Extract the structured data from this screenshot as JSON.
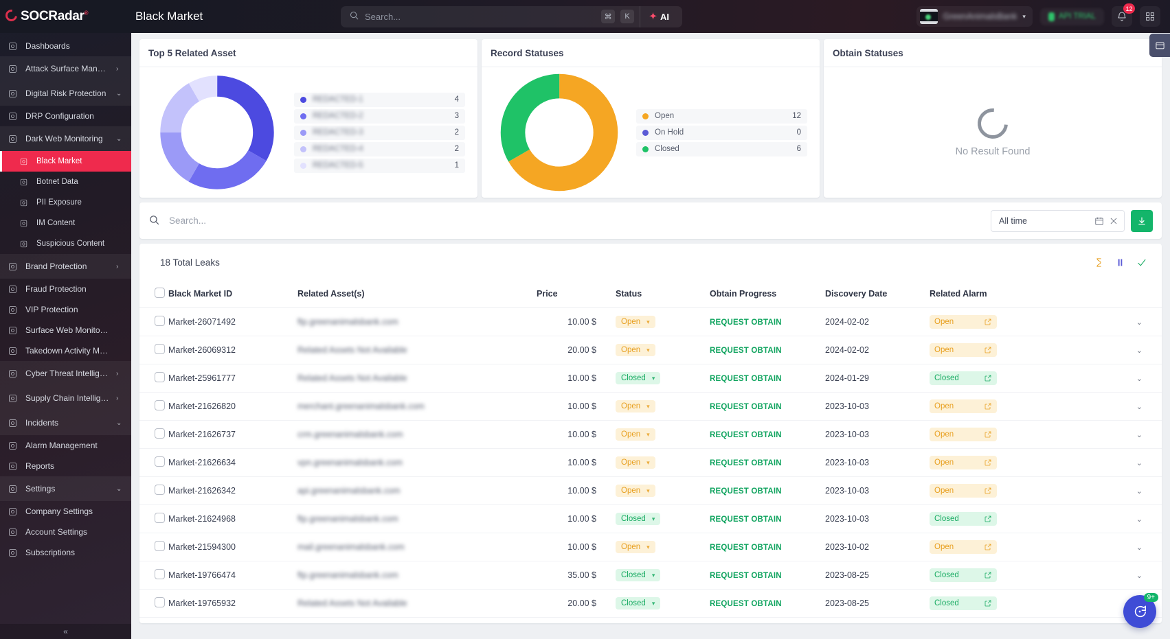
{
  "brand": {
    "name": "SOCRadar",
    "registered": "®"
  },
  "header": {
    "page_title": "Black Market",
    "search_placeholder": "Search...",
    "kbd_cmd": "⌘",
    "kbd_key": "K",
    "ai_label": "AI",
    "account_name": "GreenAnimalsBank",
    "account_caret": "▾",
    "plan_pill": "API TRIAL",
    "notifications_badge": "12",
    "icons": {
      "search": "search-icon",
      "bell": "bell-icon",
      "grid": "grid-icon"
    }
  },
  "sidebar": {
    "collapse_label": "«",
    "items": [
      {
        "label": "Dashboards",
        "icon": "dashboard-icon",
        "type": "item",
        "arrow": ""
      },
      {
        "label": "Attack Surface Management",
        "icon": "shield-scan-icon",
        "type": "group",
        "arrow": "›"
      },
      {
        "label": "Digital Risk Protection",
        "icon": "hand-shield-icon",
        "type": "group",
        "arrow": "⌄"
      },
      {
        "label": "DRP Configuration",
        "icon": "monitor-icon",
        "type": "item",
        "arrow": ""
      },
      {
        "label": "Dark Web Monitoring",
        "icon": "building-icon",
        "type": "group",
        "arrow": "⌄"
      },
      {
        "label": "Black Market",
        "icon": "market-icon",
        "type": "sub",
        "arrow": "",
        "active": true
      },
      {
        "label": "Botnet Data",
        "icon": "bug-icon",
        "type": "sub",
        "arrow": ""
      },
      {
        "label": "PII Exposure",
        "icon": "id-card-icon",
        "type": "sub",
        "arrow": ""
      },
      {
        "label": "IM Content",
        "icon": "chat-icon",
        "type": "sub",
        "arrow": ""
      },
      {
        "label": "Suspicious Content",
        "icon": "document-icon",
        "type": "sub",
        "arrow": ""
      },
      {
        "label": "Brand Protection",
        "icon": "brand-icon",
        "type": "group",
        "arrow": "›"
      },
      {
        "label": "Fraud Protection",
        "icon": "fraud-icon",
        "type": "item",
        "arrow": ""
      },
      {
        "label": "VIP Protection",
        "icon": "vip-shield-icon",
        "type": "item",
        "arrow": ""
      },
      {
        "label": "Surface Web Monitoring",
        "icon": "web-icon",
        "type": "item",
        "arrow": ""
      },
      {
        "label": "Takedown Activity Management",
        "icon": "takedown-icon",
        "type": "item",
        "arrow": ""
      },
      {
        "label": "Cyber Threat Intelligence",
        "icon": "eye-shield-icon",
        "type": "group",
        "arrow": "›"
      },
      {
        "label": "Supply Chain Intelligence",
        "icon": "factory-icon",
        "type": "group",
        "arrow": "›"
      },
      {
        "label": "Incidents",
        "icon": "incident-icon",
        "type": "group",
        "arrow": "⌄"
      },
      {
        "label": "Alarm Management",
        "icon": "alarm-icon",
        "type": "item",
        "arrow": ""
      },
      {
        "label": "Reports",
        "icon": "report-icon",
        "type": "item",
        "arrow": ""
      },
      {
        "label": "Settings",
        "icon": "gear-icon",
        "type": "group",
        "arrow": "⌄"
      },
      {
        "label": "Company Settings",
        "icon": "company-icon",
        "type": "item",
        "arrow": ""
      },
      {
        "label": "Account Settings",
        "icon": "user-icon",
        "type": "item",
        "arrow": ""
      },
      {
        "label": "Subscriptions",
        "icon": "subscription-icon",
        "type": "item",
        "arrow": ""
      }
    ]
  },
  "cards": [
    {
      "title": "Top 5 Related Asset"
    },
    {
      "title": "Record Statuses"
    },
    {
      "title": "Obtain Statuses"
    }
  ],
  "obtain_statuses": {
    "empty_text": "No Result Found"
  },
  "chart_data": [
    {
      "type": "pie",
      "title": "Top 5 Related Asset",
      "legend_position": "right",
      "categories": [
        "REDACTED-1",
        "REDACTED-2",
        "REDACTED-3",
        "REDACTED-4",
        "REDACTED-5"
      ],
      "values": [
        4,
        3,
        2,
        2,
        1
      ],
      "colors": [
        "#4c4ae0",
        "#6f6df0",
        "#9b9af7",
        "#c3c2fb",
        "#e2e1fe"
      ],
      "redacted_labels": true
    },
    {
      "type": "pie",
      "title": "Record Statuses",
      "legend_position": "right",
      "categories": [
        "Open",
        "On Hold",
        "Closed"
      ],
      "values": [
        12,
        0,
        6
      ],
      "colors": [
        "#f5a623",
        "#5b5bd6",
        "#1fc267"
      ]
    },
    {
      "type": "pie",
      "title": "Obtain Statuses",
      "categories": [],
      "values": [],
      "empty": true,
      "empty_text": "No Result Found"
    }
  ],
  "filter": {
    "search_placeholder": "Search...",
    "date_range": "All time",
    "calendar_icon": "calendar-icon",
    "clear_icon": "close-icon",
    "download_icon": "download-icon"
  },
  "table": {
    "total_label": "18 Total Leaks",
    "tools": [
      "hourglass-icon",
      "pause-icon",
      "check-icon"
    ],
    "columns": [
      "Black Market ID",
      "Related Asset(s)",
      "Price",
      "Status",
      "Obtain Progress",
      "Discovery Date",
      "Related Alarm"
    ],
    "obtain_action_label": "REQUEST OBTAIN",
    "rows": [
      {
        "id": "Market-26071492",
        "asset": "ftp.greenanimalsbank.com",
        "price": "10.00 $",
        "status": "Open",
        "obtain": "REQUEST OBTAIN",
        "date": "2024-02-02",
        "alarm": "Open"
      },
      {
        "id": "Market-26069312",
        "asset": "Related Assets Not Available",
        "price": "20.00 $",
        "status": "Open",
        "obtain": "REQUEST OBTAIN",
        "date": "2024-02-02",
        "alarm": "Open"
      },
      {
        "id": "Market-25961777",
        "asset": "Related Assets Not Available",
        "price": "10.00 $",
        "status": "Closed",
        "obtain": "REQUEST OBTAIN",
        "date": "2024-01-29",
        "alarm": "Closed"
      },
      {
        "id": "Market-21626820",
        "asset": "merchant.greenanimalsbank.com",
        "price": "10.00 $",
        "status": "Open",
        "obtain": "REQUEST OBTAIN",
        "date": "2023-10-03",
        "alarm": "Open"
      },
      {
        "id": "Market-21626737",
        "asset": "crm.greenanimalsbank.com",
        "price": "10.00 $",
        "status": "Open",
        "obtain": "REQUEST OBTAIN",
        "date": "2023-10-03",
        "alarm": "Open"
      },
      {
        "id": "Market-21626634",
        "asset": "vpn.greenanimalsbank.com",
        "price": "10.00 $",
        "status": "Open",
        "obtain": "REQUEST OBTAIN",
        "date": "2023-10-03",
        "alarm": "Open"
      },
      {
        "id": "Market-21626342",
        "asset": "api.greenanimalsbank.com",
        "price": "10.00 $",
        "status": "Open",
        "obtain": "REQUEST OBTAIN",
        "date": "2023-10-03",
        "alarm": "Open"
      },
      {
        "id": "Market-21624968",
        "asset": "ftp.greenanimalsbank.com",
        "price": "10.00 $",
        "status": "Closed",
        "obtain": "REQUEST OBTAIN",
        "date": "2023-10-03",
        "alarm": "Closed"
      },
      {
        "id": "Market-21594300",
        "asset": "mail.greenanimalsbank.com",
        "price": "10.00 $",
        "status": "Open",
        "obtain": "REQUEST OBTAIN",
        "date": "2023-10-02",
        "alarm": "Open"
      },
      {
        "id": "Market-19766474",
        "asset": "ftp.greenanimalsbank.com",
        "price": "35.00 $",
        "status": "Closed",
        "obtain": "REQUEST OBTAIN",
        "date": "2023-08-25",
        "alarm": "Closed"
      },
      {
        "id": "Market-19765932",
        "asset": "Related Assets Not Available",
        "price": "20.00 $",
        "status": "Closed",
        "obtain": "REQUEST OBTAIN",
        "date": "2023-08-25",
        "alarm": "Closed"
      }
    ]
  },
  "chat_widget": {
    "badge": "9+",
    "icon": "help-chat-icon"
  },
  "colors": {
    "accent_red": "#ef2a4d",
    "green": "#13b56a",
    "orange": "#f5a623",
    "purple": "#5b5bd6"
  }
}
